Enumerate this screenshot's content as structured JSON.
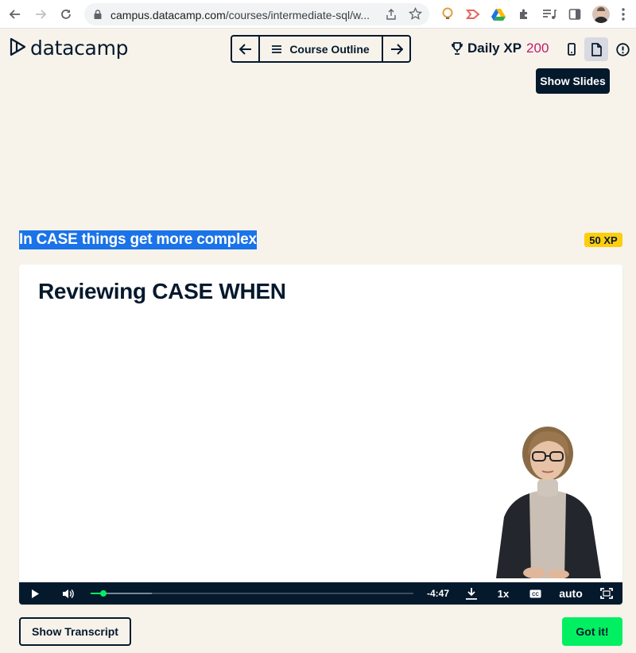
{
  "browser": {
    "url_host": "campus.datacamp.com",
    "url_path": "/courses/intermediate-sql/w..."
  },
  "header": {
    "logo_text": "datacamp",
    "course_outline_label": "Course Outline",
    "daily_xp_label": "Daily XP",
    "daily_xp_value": "200",
    "tooltip": "Show Slides"
  },
  "exercise": {
    "title": "In CASE things get more complex",
    "xp_badge": "50 XP"
  },
  "video": {
    "slide_title": "Reviewing CASE WHEN",
    "time_remaining": "-4:47",
    "speed": "1x",
    "quality": "auto",
    "progress": 0.04,
    "buffered": 0.19
  },
  "footer": {
    "transcript_button": "Show Transcript",
    "got_it_button": "Got it!"
  },
  "colors": {
    "background": "#f7f3eb",
    "navy": "#05192d",
    "accent_green": "#03ef62",
    "xp_pink": "#c01c6c",
    "badge_yellow": "#fcce0d",
    "selection_blue": "#1a73e8"
  }
}
